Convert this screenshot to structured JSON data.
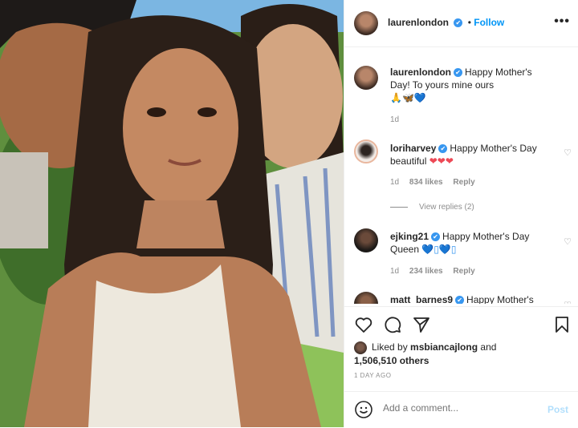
{
  "header": {
    "username": "laurenlondon",
    "verified_mark": "✔",
    "separator": "•",
    "follow_label": "Follow",
    "more_label": "•••"
  },
  "caption": {
    "username": "laurenlondon",
    "text": "Happy Mother's Day! To yours mine ours",
    "emoji": "🙏🦋💙",
    "age": "1d"
  },
  "comments": [
    {
      "username": "loriharvey",
      "text": "Happy Mother's Day beautiful",
      "emoji": "❤❤❤",
      "age": "1d",
      "likes": "834 likes",
      "reply_label": "Reply",
      "view_replies": "View replies (2)"
    },
    {
      "username": "ejking21",
      "text": "Happy Mother's Day Queen",
      "emoji": "💙▯💙▯",
      "age": "1d",
      "likes": "234 likes",
      "reply_label": "Reply"
    },
    {
      "username": "matt_barnes9",
      "text": "Happy Mother's"
    }
  ],
  "actions": {
    "like_icon": "heart-icon",
    "comment_icon": "comment-icon",
    "share_icon": "share-icon",
    "save_icon": "bookmark-icon"
  },
  "likes": {
    "prefix": "Liked by ",
    "user": "msbiancajlong",
    "conj": " and",
    "count": "1,506,510 others"
  },
  "timestamp": "1 DAY AGO",
  "add_comment": {
    "placeholder": "Add a comment...",
    "post_label": "Post"
  },
  "colors": {
    "accent": "#0095f6",
    "verified": "#3897f0",
    "muted": "#8e8e8e"
  }
}
